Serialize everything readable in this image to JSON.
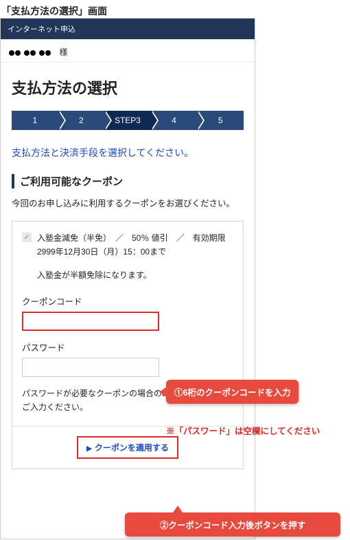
{
  "caption": "「支払方法の選択」画面",
  "appbar": {
    "title": "インターネット申込"
  },
  "user": {
    "suffix": "様"
  },
  "page": {
    "title": "支払方法の選択",
    "lead": "支払方法と決済手段を選択してください。"
  },
  "stepper": {
    "steps": [
      "1",
      "2",
      "STEP3",
      "4",
      "5"
    ],
    "active_index": 2
  },
  "coupon_section": {
    "title": "ご利用可能なクーポン",
    "desc": "今回のお申し込みに利用するクーポンをお選びください。",
    "item": {
      "checked": true,
      "line1": "入塾金減免（半免）　／　50％ 値引　／　有効期限　2999年12月30日（月）15：00まで",
      "note": "入塾金が半額免除になります。"
    },
    "code": {
      "label": "クーポンコード",
      "value": ""
    },
    "password": {
      "label": "パスワード",
      "value": ""
    },
    "pw_note": "パスワードが必要なクーポンの場合のみ、パスワードをご入力ください。",
    "apply_label": "クーポンを適用する"
  },
  "callouts": {
    "code": "①6桁のクーポンコードを入力",
    "pw_empty": "※「パスワード」は空欄にしてください",
    "apply": "②クーポンコード入力後ボタンを押す"
  }
}
